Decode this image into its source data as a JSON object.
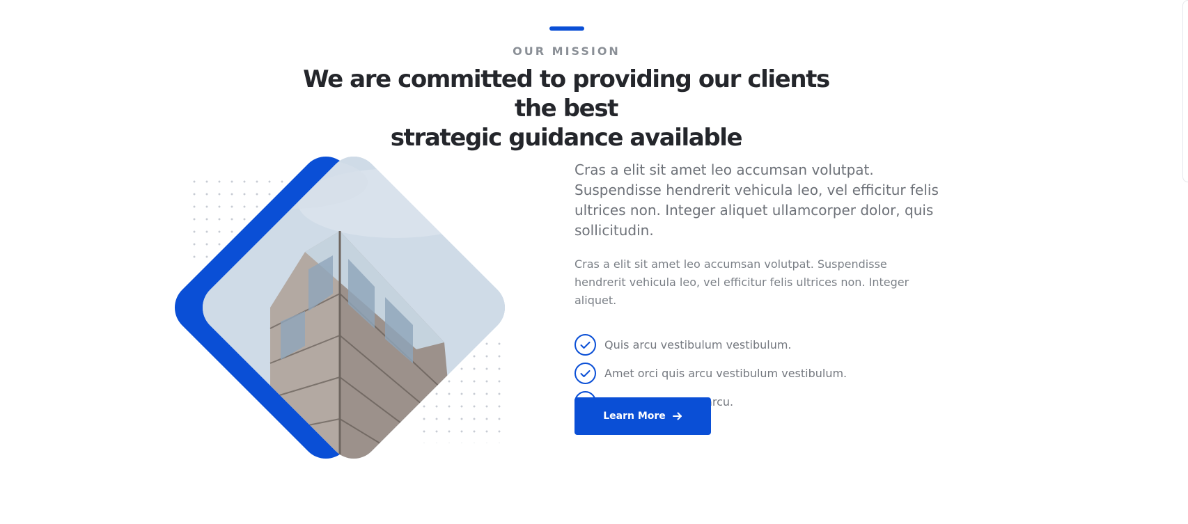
{
  "mission": {
    "eyebrow": "OUR MISSION",
    "headline_line1": "We are committed to providing our clients the best",
    "headline_line2": "strategic guidance available"
  },
  "content": {
    "lead": "Cras a elit sit amet leo accumsan volutpat. Suspendisse hendrerit vehicula leo, vel efficitur felis ultrices non. Integer aliquet ullamcorper dolor, quis sollicitudin.",
    "body": "Cras a elit sit amet leo accumsan volutpat. Suspendisse hendrerit vehicula leo, vel efficitur felis ultrices non. Integer aliquet.",
    "checklist": [
      {
        "label": "Quis arcu vestibulum vestibulum.",
        "icon": "check-circle-icon"
      },
      {
        "label": "Amet orci quis arcu vestibulum vestibulum.",
        "icon": "check-circle-icon"
      },
      {
        "label": "Sit amet orci quis arcu.",
        "icon": "check-circle-icon"
      }
    ],
    "cta": {
      "label": "Learn More",
      "icon": "arrow-right-icon"
    }
  },
  "colors": {
    "accent": "#0a4fd6",
    "heading": "#24262b",
    "muted_text": "#6d7178"
  }
}
